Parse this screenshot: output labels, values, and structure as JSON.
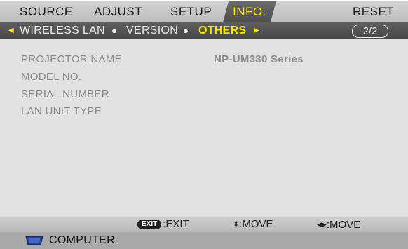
{
  "menu": {
    "tabs": [
      {
        "label": "SOURCE"
      },
      {
        "label": "ADJUST"
      },
      {
        "label": "SETUP"
      },
      {
        "label": "INFO."
      },
      {
        "label": "RESET"
      }
    ],
    "active_tab": "INFO."
  },
  "submenu": {
    "items": [
      {
        "label": "WIRELESS LAN"
      },
      {
        "label": "VERSION"
      },
      {
        "label": "OTHERS"
      }
    ],
    "selected": "OTHERS",
    "separator": "●",
    "page": "2/2"
  },
  "info": {
    "rows": [
      {
        "label": "PROJECTOR NAME",
        "value": "NP-UM330 Series"
      },
      {
        "label": "MODEL NO.",
        "value": ""
      },
      {
        "label": "SERIAL NUMBER",
        "value": ""
      },
      {
        "label": "LAN UNIT TYPE",
        "value": ""
      }
    ]
  },
  "help": {
    "exit_key": "EXIT",
    "exit_text": ":EXIT",
    "move_vertical": ":MOVE",
    "move_horizontal": ":MOVE"
  },
  "source": {
    "label": "COMPUTER",
    "icon": "vga-connector-icon"
  },
  "colors": {
    "highlight": "#ffe500",
    "tab_bar": "#c8c8c8",
    "sub_bar": "#545454",
    "content_bg": "#e2e2e2",
    "label_text": "#8b8b8b"
  }
}
